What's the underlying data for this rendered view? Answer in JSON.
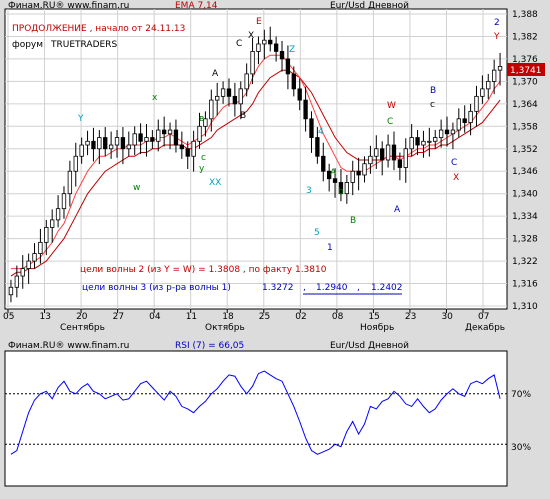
{
  "main_panel": {
    "source": "Финам.RU® www.finam.ru",
    "indicator": "EMA 7,14",
    "symbol": "Eur/Usd Дневной",
    "note_title": "ПРОДОЛЖЕНИЕ , начало от 24.11.13",
    "forum_label": "форум",
    "forum_name": "TRUETRADERS",
    "target2_text": "цели волны 2 (из Y = W) = 1.3808 , по факту 1.3810",
    "target3_prefix": "цели волны 3 (из р-ра волны 1)",
    "target3_values": [
      "1.3272",
      ",",
      "1.2940",
      ",",
      "1.2402"
    ],
    "last_price_label": "1,3741"
  },
  "rsi_panel": {
    "source": "Финам.RU® www.finam.ru",
    "indicator": "RSI (7) = 66,05",
    "symbol": "Eur/Usd Дневной",
    "levels": [
      "70%",
      "30%"
    ]
  },
  "chart_data": [
    {
      "type": "candlestick",
      "title": "Eur/Usd Дневной",
      "ylim": [
        1.31,
        1.388
      ],
      "y_ticks": [
        "1,388",
        "1,382",
        "1,376",
        "1,370",
        "1,364",
        "1,358",
        "1,352",
        "1,346",
        "1,340",
        "1,334",
        "1,328",
        "1,322",
        "1,316",
        "1,310"
      ],
      "x_ticks": [
        "05",
        "13",
        "20",
        "27",
        "04",
        "11",
        "18",
        "25",
        "02",
        "08",
        "15",
        "23",
        "30",
        "07"
      ],
      "months": [
        "Сентябрь",
        "Октябрь",
        "Ноябрь",
        "Декабрь"
      ],
      "close": [
        1.315,
        1.318,
        1.32,
        1.322,
        1.324,
        1.327,
        1.331,
        1.333,
        1.336,
        1.34,
        1.346,
        1.35,
        1.353,
        1.354,
        1.352,
        1.355,
        1.352,
        1.353,
        1.355,
        1.352,
        1.353,
        1.356,
        1.354,
        1.355,
        1.354,
        1.357,
        1.356,
        1.357,
        1.353,
        1.352,
        1.35,
        1.354,
        1.358,
        1.36,
        1.365,
        1.366,
        1.368,
        1.366,
        1.364,
        1.368,
        1.372,
        1.378,
        1.38,
        1.381,
        1.38,
        1.378,
        1.376,
        1.372,
        1.368,
        1.365,
        1.36,
        1.355,
        1.35,
        1.346,
        1.344,
        1.343,
        1.34,
        1.343,
        1.346,
        1.345,
        1.348,
        1.35,
        1.352,
        1.349,
        1.353,
        1.349,
        1.347,
        1.352,
        1.355,
        1.353,
        1.354,
        1.354,
        1.355,
        1.357,
        1.356,
        1.357,
        1.36,
        1.359,
        1.362,
        1.366,
        1.368,
        1.37,
        1.373,
        1.374
      ],
      "ema_fast": [
        1.32,
        1.32,
        1.32,
        1.321,
        1.322,
        1.323,
        1.325,
        1.327,
        1.33,
        1.332,
        1.336,
        1.34,
        1.343,
        1.346,
        1.348,
        1.35,
        1.35,
        1.351,
        1.352,
        1.352,
        1.353,
        1.353,
        1.353,
        1.354,
        1.354,
        1.355,
        1.355,
        1.356,
        1.355,
        1.354,
        1.353,
        1.354,
        1.355,
        1.356,
        1.359,
        1.361,
        1.363,
        1.364,
        1.364,
        1.365,
        1.367,
        1.371,
        1.374,
        1.376,
        1.377,
        1.377,
        1.377,
        1.375,
        1.373,
        1.371,
        1.368,
        1.364,
        1.36,
        1.356,
        1.353,
        1.35,
        1.347,
        1.346,
        1.346,
        1.346,
        1.346,
        1.347,
        1.348,
        1.349,
        1.35,
        1.35,
        1.349,
        1.35,
        1.351,
        1.352,
        1.352,
        1.353,
        1.353,
        1.354,
        1.355,
        1.356,
        1.357,
        1.358,
        1.359,
        1.361,
        1.363,
        1.365,
        1.368,
        1.37
      ],
      "ema_slow": [
        1.318,
        1.319,
        1.319,
        1.32,
        1.32,
        1.321,
        1.322,
        1.324,
        1.326,
        1.328,
        1.331,
        1.334,
        1.337,
        1.34,
        1.342,
        1.344,
        1.346,
        1.347,
        1.348,
        1.349,
        1.35,
        1.35,
        1.351,
        1.351,
        1.352,
        1.352,
        1.353,
        1.353,
        1.353,
        1.353,
        1.352,
        1.352,
        1.353,
        1.354,
        1.355,
        1.357,
        1.358,
        1.359,
        1.36,
        1.361,
        1.362,
        1.364,
        1.367,
        1.369,
        1.371,
        1.372,
        1.373,
        1.373,
        1.372,
        1.371,
        1.369,
        1.367,
        1.364,
        1.361,
        1.358,
        1.355,
        1.353,
        1.351,
        1.35,
        1.349,
        1.349,
        1.349,
        1.349,
        1.349,
        1.35,
        1.35,
        1.35,
        1.35,
        1.35,
        1.351,
        1.351,
        1.352,
        1.352,
        1.353,
        1.353,
        1.354,
        1.355,
        1.356,
        1.357,
        1.358,
        1.359,
        1.361,
        1.363,
        1.365
      ]
    },
    {
      "type": "line",
      "title": "RSI (7) = 66,05",
      "ylim": [
        0,
        100
      ],
      "levels": [
        70,
        30
      ],
      "values": [
        22,
        25,
        40,
        55,
        65,
        70,
        72,
        66,
        75,
        80,
        72,
        70,
        75,
        78,
        72,
        70,
        66,
        68,
        70,
        65,
        66,
        72,
        78,
        80,
        75,
        70,
        65,
        72,
        68,
        60,
        58,
        55,
        60,
        64,
        70,
        74,
        80,
        85,
        84,
        76,
        70,
        76,
        86,
        88,
        85,
        82,
        80,
        70,
        60,
        48,
        35,
        25,
        22,
        24,
        26,
        30,
        28,
        40,
        48,
        38,
        46,
        60,
        58,
        64,
        66,
        72,
        68,
        62,
        60,
        66,
        60,
        55,
        58,
        65,
        70,
        74,
        70,
        68,
        78,
        80,
        78,
        82,
        85,
        66
      ]
    }
  ]
}
